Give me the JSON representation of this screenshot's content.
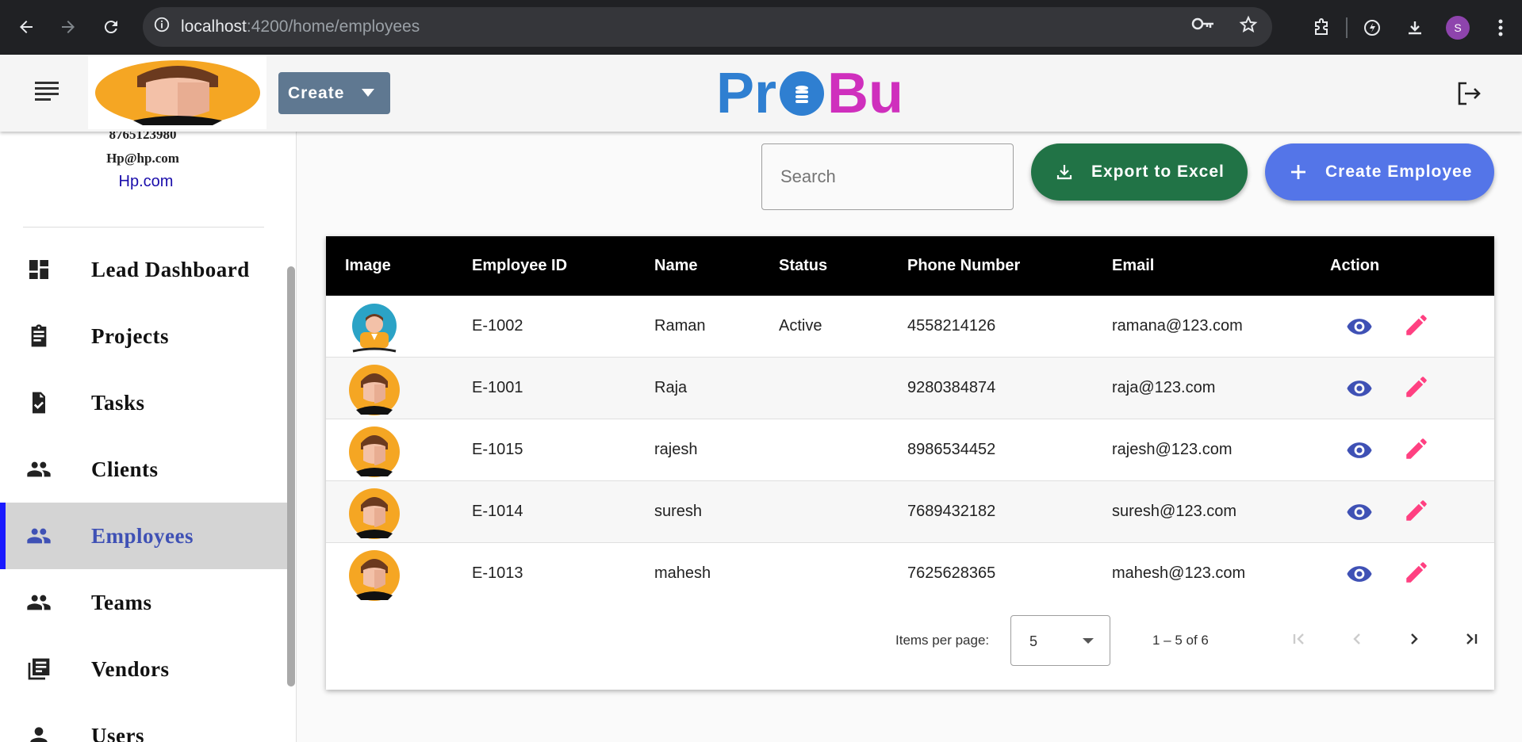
{
  "browser": {
    "url_host": "localhost",
    "url_path": ":4200/home/employees",
    "profile_initial": "S"
  },
  "header": {
    "create_label": "Create",
    "brand_left": "Pr",
    "brand_right": "Bu"
  },
  "sidebar": {
    "phone": "8765123980",
    "email": "Hp@hp.com",
    "website": "Hp.com",
    "items": [
      {
        "label": "Lead Dashboard",
        "icon": "dashboard-icon"
      },
      {
        "label": "Projects",
        "icon": "assignment-icon"
      },
      {
        "label": "Tasks",
        "icon": "task-icon"
      },
      {
        "label": "Clients",
        "icon": "people-icon"
      },
      {
        "label": "Employees",
        "icon": "people-icon",
        "active": true
      },
      {
        "label": "Teams",
        "icon": "people-icon"
      },
      {
        "label": "Vendors",
        "icon": "library-books-icon"
      },
      {
        "label": "Users",
        "icon": "person-icon"
      }
    ]
  },
  "toolbar": {
    "search_placeholder": "Search",
    "export_label": "Export to Excel",
    "create_employee_label": "Create Employee"
  },
  "table": {
    "columns": [
      "Image",
      "Employee ID",
      "Name",
      "Status",
      "Phone Number",
      "Email",
      "Action"
    ],
    "rows": [
      {
        "id": "E-1002",
        "name": "Raman",
        "status": "Active",
        "phone": "4558214126",
        "email": "ramana@123.com"
      },
      {
        "id": "E-1001",
        "name": "Raja",
        "status": "",
        "phone": "9280384874",
        "email": "raja@123.com"
      },
      {
        "id": "E-1015",
        "name": "rajesh",
        "status": "",
        "phone": "8986534452",
        "email": "rajesh@123.com"
      },
      {
        "id": "E-1014",
        "name": "suresh",
        "status": "",
        "phone": "7689432182",
        "email": "suresh@123.com"
      },
      {
        "id": "E-1013",
        "name": "mahesh",
        "status": "",
        "phone": "7625628365",
        "email": "mahesh@123.com"
      }
    ]
  },
  "paginator": {
    "items_per_page_label": "Items per page:",
    "items_per_page_value": "5",
    "range_label": "1 – 5 of 6"
  },
  "colors": {
    "export_button": "#217346",
    "create_employee_button": "#5475e8",
    "view_icon": "#3f51b5",
    "edit_icon": "#ff4081",
    "active_nav": "#3f51b5"
  }
}
